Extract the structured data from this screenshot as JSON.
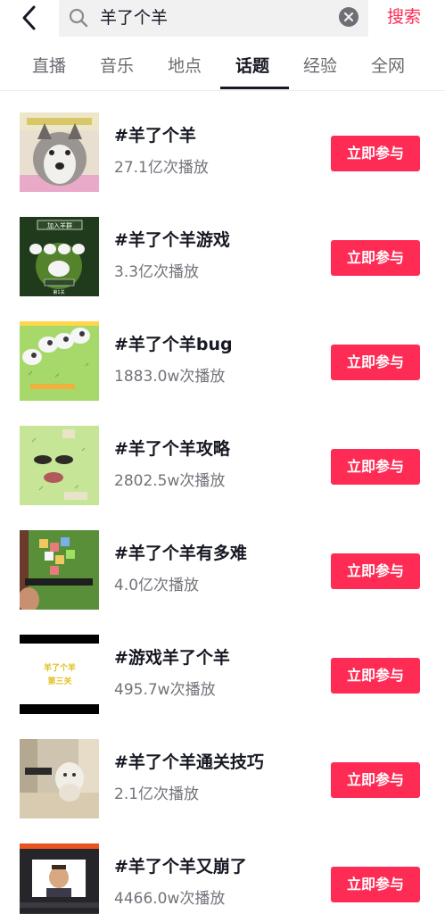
{
  "search": {
    "query": "羊了个羊",
    "submit_label": "搜索"
  },
  "tabs": [
    {
      "label": "直播"
    },
    {
      "label": "音乐"
    },
    {
      "label": "地点"
    },
    {
      "label": "话题"
    },
    {
      "label": "经验"
    },
    {
      "label": "全网"
    }
  ],
  "active_tab": "话题",
  "colors": {
    "accent": "#fe2c55",
    "text": "#161823",
    "muted": "#72737a"
  },
  "topics": [
    {
      "title": "#羊了个羊",
      "plays": "27.1亿次播放",
      "button": "立即参与",
      "thumb": "husky-meme"
    },
    {
      "title": "#羊了个羊游戏",
      "plays": "3.3亿次播放",
      "button": "立即参与",
      "thumb": "game-start-screen",
      "thumb_text": {
        "top": "加入羊群",
        "bottom": "第1关"
      }
    },
    {
      "title": "#羊了个羊bug",
      "plays": "1883.0w次播放",
      "button": "立即参与",
      "thumb": "sheep-on-grass"
    },
    {
      "title": "#羊了个羊攻略",
      "plays": "2802.5w次播放",
      "button": "立即参与",
      "thumb": "face-on-grass"
    },
    {
      "title": "#羊了个羊有多难",
      "plays": "4.0亿次播放",
      "button": "立即参与",
      "thumb": "game-tiles-on-phone"
    },
    {
      "title": "#游戏羊了个羊",
      "plays": "495.7w次播放",
      "button": "立即参与",
      "thumb": "yellow-text-card",
      "thumb_text": {
        "line1": "羊了个羊",
        "line2": "第三关"
      }
    },
    {
      "title": "#羊了个羊通关技巧",
      "plays": "2.1亿次播放",
      "button": "立即参与",
      "thumb": "dog-in-hallway"
    },
    {
      "title": "#羊了个羊又崩了",
      "plays": "4466.0w次播放",
      "button": "立即参与",
      "thumb": "streamer-screen"
    }
  ]
}
